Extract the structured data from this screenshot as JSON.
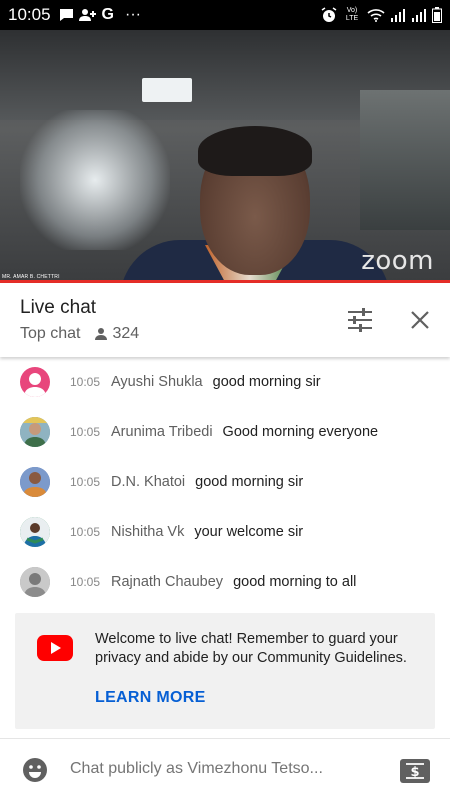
{
  "status_bar": {
    "time": "10:05",
    "left_icons": [
      "message-icon",
      "person-add-icon",
      "google-icon",
      "more-icon"
    ],
    "google_letter": "G",
    "more": "···",
    "right_icons": [
      "alarm-icon",
      "volte-icon",
      "wifi-icon",
      "signal-icon",
      "signal-icon",
      "battery-icon"
    ],
    "volte_label": "Vo) LTE"
  },
  "video": {
    "watermark": "zoom",
    "name_tag": "MR. AMAR B. CHETTRI",
    "progress_color": "#e52d27"
  },
  "chat_header": {
    "title": "Live chat",
    "mode": "Top chat",
    "viewer_count": "324",
    "tune_icon": "tune-icon",
    "close_icon": "close-icon"
  },
  "messages": [
    {
      "time": "10:05",
      "author": "Ayushi Shukla",
      "text": "good morning sir",
      "avatar_color": "#e8467c"
    },
    {
      "time": "10:05",
      "author": "Arunima Tribedi",
      "text": "Good morning everyone",
      "avatar_color": "#6f8f9e"
    },
    {
      "time": "10:05",
      "author": "D.N. Khatoi",
      "text": "good morning sir",
      "avatar_color": "#5578b8"
    },
    {
      "time": "10:05",
      "author": "Nishitha Vk",
      "text": "your welcome sir",
      "avatar_color": "#2e8b57"
    },
    {
      "time": "10:05",
      "author": "Rajnath Chaubey",
      "text": "good morning to all",
      "avatar_color": "#9a9a9a"
    }
  ],
  "welcome": {
    "text": "Welcome to live chat! Remember to guard your privacy and abide by our Community Guidelines.",
    "learn_more": "LEARN MORE",
    "logo_color": "#ff0000",
    "link_color": "#065fd4"
  },
  "input": {
    "placeholder": "Chat publicly as Vimezhonu Tetso...",
    "emoji_icon": "emoji-icon",
    "superchat_icon": "superchat-icon"
  }
}
